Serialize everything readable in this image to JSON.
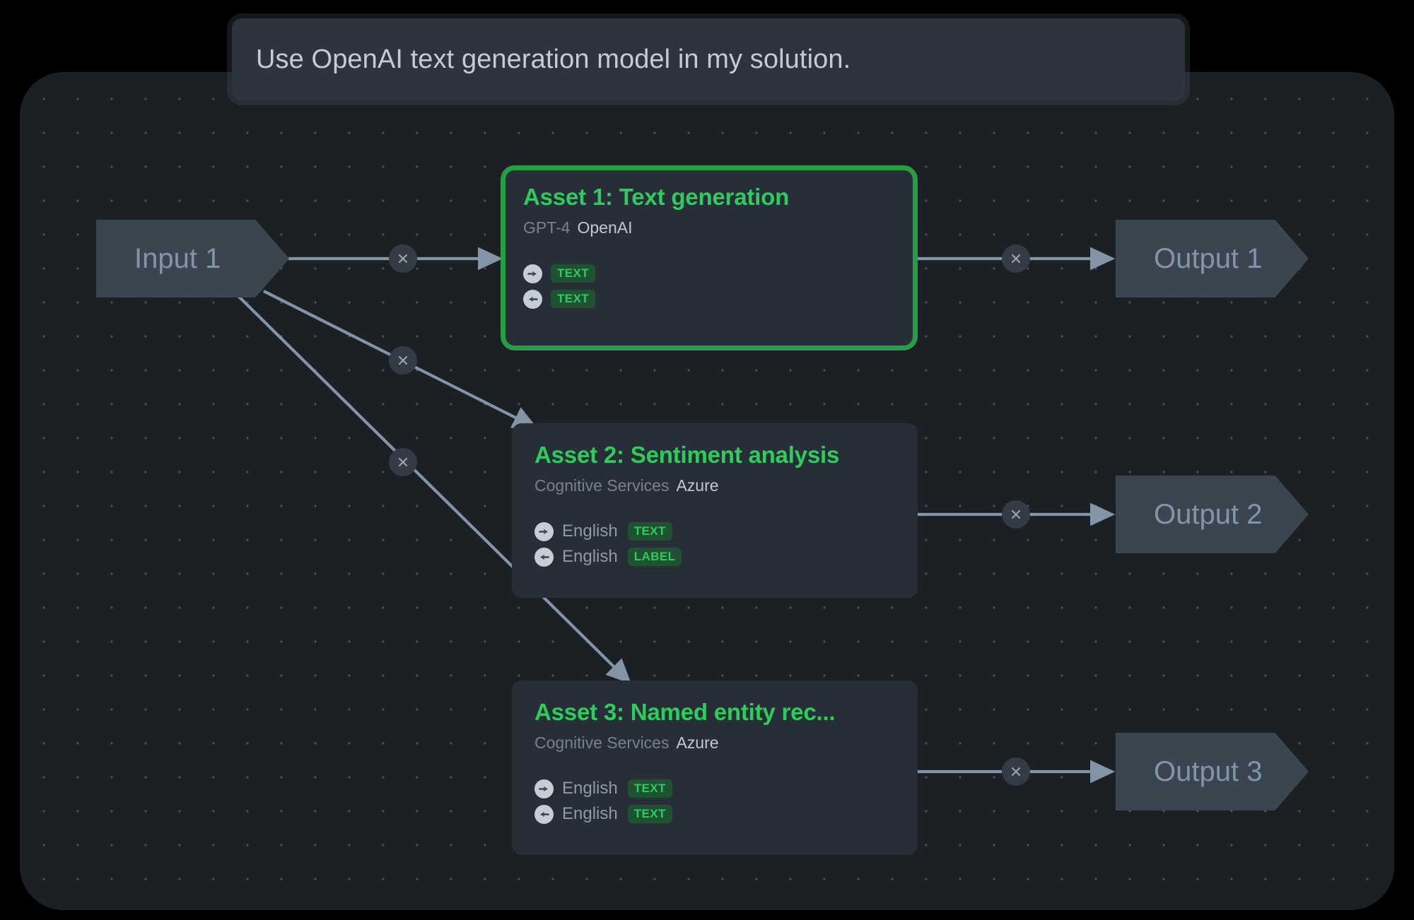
{
  "header": {
    "prompt_text": "Use OpenAI text generation model in my solution."
  },
  "colors": {
    "canvas_bg": "#1b2024",
    "card_bg": "#272e37",
    "node_bg": "#3b4550",
    "accent_green": "#2ecc5c",
    "selected_border_green": "#259e44",
    "badge_bg": "#1f5233",
    "edge_line": "#8294a6",
    "node_label": "#8295a8"
  },
  "nodes": {
    "inputs": [
      {
        "id": "input-1",
        "label": "Input 1"
      }
    ],
    "outputs": [
      {
        "id": "output-1",
        "label": "Output 1"
      },
      {
        "id": "output-2",
        "label": "Output 2"
      },
      {
        "id": "output-3",
        "label": "Output 3"
      }
    ]
  },
  "assets": [
    {
      "id": "asset-1",
      "title": "Asset 1: Text generation",
      "service": "GPT-4",
      "vendor": "OpenAI",
      "selected": true,
      "input_port": {
        "lang": "",
        "type": "TEXT",
        "icon": "arrow-right-circle-icon"
      },
      "output_port": {
        "lang": "",
        "type": "TEXT",
        "icon": "arrow-left-circle-icon"
      }
    },
    {
      "id": "asset-2",
      "title": "Asset 2: Sentiment analysis",
      "service": "Cognitive Services",
      "vendor": "Azure",
      "selected": false,
      "input_port": {
        "lang": "English",
        "type": "TEXT",
        "icon": "arrow-right-circle-icon"
      },
      "output_port": {
        "lang": "English",
        "type": "LABEL",
        "icon": "arrow-left-circle-icon"
      }
    },
    {
      "id": "asset-3",
      "title": "Asset 3: Named entity rec...",
      "service": "Cognitive Services",
      "vendor": "Azure",
      "selected": false,
      "input_port": {
        "lang": "English",
        "type": "TEXT",
        "icon": "arrow-right-circle-icon"
      },
      "output_port": {
        "lang": "English",
        "type": "TEXT",
        "icon": "arrow-left-circle-icon"
      }
    }
  ],
  "edges": [
    {
      "id": "edge-input1-asset1",
      "from": "input-1",
      "to": "asset-1",
      "delete_label": "×"
    },
    {
      "id": "edge-input1-asset2",
      "from": "input-1",
      "to": "asset-2",
      "delete_label": "×"
    },
    {
      "id": "edge-input1-asset3",
      "from": "input-1",
      "to": "asset-3",
      "delete_label": "×"
    },
    {
      "id": "edge-asset1-output1",
      "from": "asset-1",
      "to": "output-1",
      "delete_label": "×"
    },
    {
      "id": "edge-asset2-output2",
      "from": "asset-2",
      "to": "output-2",
      "delete_label": "×"
    },
    {
      "id": "edge-asset3-output3",
      "from": "asset-3",
      "to": "output-3",
      "delete_label": "×"
    }
  ]
}
